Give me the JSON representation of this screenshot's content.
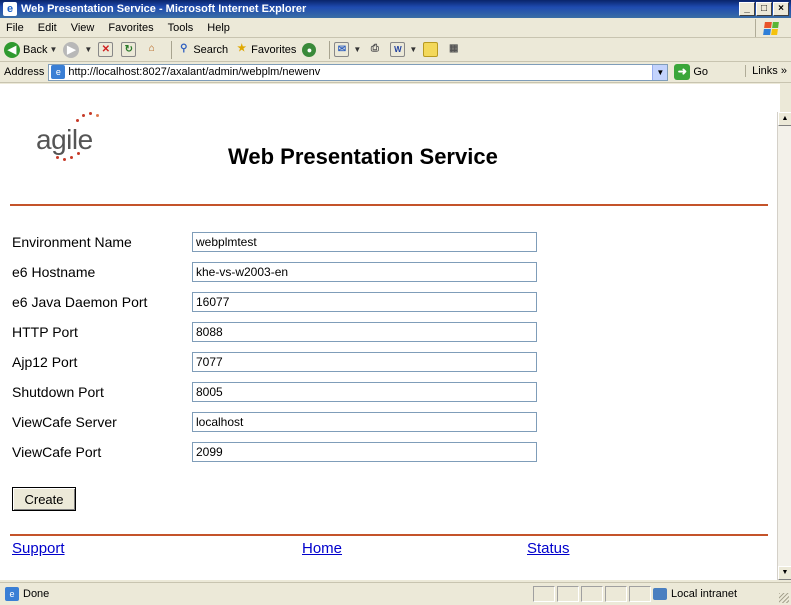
{
  "window": {
    "title": "Web Presentation Service - Microsoft Internet Explorer",
    "min": "_",
    "max": "□",
    "close": "×"
  },
  "menu": [
    "File",
    "Edit",
    "View",
    "Favorites",
    "Tools",
    "Help"
  ],
  "toolbar": {
    "back": "Back",
    "search": "Search",
    "favorites": "Favorites"
  },
  "address": {
    "label": "Address",
    "url": "http://localhost:8027/axalant/admin/webplm/newenv",
    "go": "Go",
    "links": "Links"
  },
  "page": {
    "logo_text": "agile",
    "title": "Web Presentation Service",
    "fields": [
      {
        "label": "Environment Name",
        "value": "webplmtest"
      },
      {
        "label": "e6 Hostname",
        "value": "khe-vs-w2003-en"
      },
      {
        "label": "e6 Java Daemon Port",
        "value": "16077"
      },
      {
        "label": "HTTP Port",
        "value": "8088"
      },
      {
        "label": "Ajp12 Port",
        "value": "7077"
      },
      {
        "label": "Shutdown Port",
        "value": "8005"
      },
      {
        "label": "ViewCafe Server",
        "value": "localhost"
      },
      {
        "label": "ViewCafe Port",
        "value": "2099"
      }
    ],
    "create_label": "Create",
    "footer": {
      "support": "Support",
      "home": "Home",
      "status": "Status"
    }
  },
  "status": {
    "text": "Done",
    "zone": "Local intranet"
  },
  "colors": {
    "accent_rule": "#c4532a",
    "link": "#0000cc",
    "titlebar": "#0a246a"
  },
  "icons": [
    "ie-icon",
    "windows-flag-icon",
    "back-icon",
    "forward-icon",
    "stop-icon",
    "refresh-icon",
    "home-icon",
    "search-icon",
    "favorites-icon",
    "media-icon",
    "mail-icon",
    "print-icon",
    "edit-icon",
    "discuss-icon",
    "research-icon",
    "go-icon",
    "page-icon",
    "intranet-icon"
  ]
}
